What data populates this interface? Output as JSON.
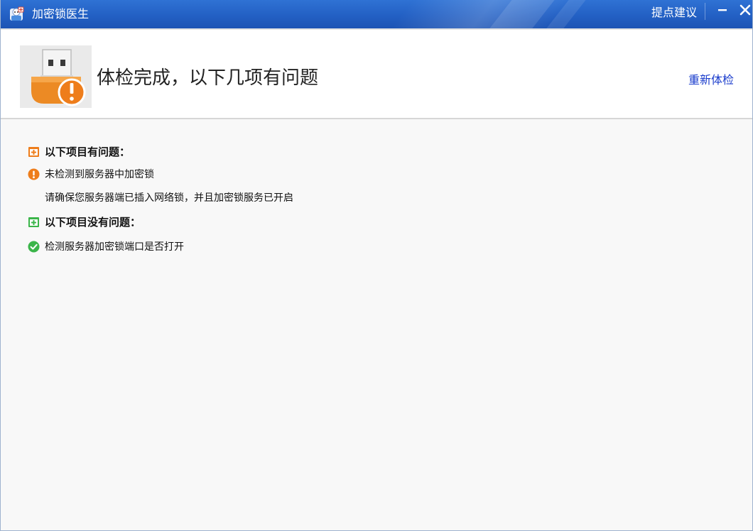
{
  "window": {
    "title": "加密锁医生",
    "feedback_link": "提点建议",
    "app_icon": "doctor-icon",
    "minimize_icon": "minimize-icon",
    "close_icon": "close-icon"
  },
  "header": {
    "image_icon": "usb-dongle-warning-icon",
    "headline": "体检完成，以下几项有问题",
    "recheck_label": "重新体检"
  },
  "results": {
    "problem_section": {
      "icon": "medical-kit-orange-icon",
      "label": "以下项目有问题："
    },
    "problem_items": [
      {
        "icon": "warning-icon",
        "label": "未检测到服务器中加密锁",
        "detail": "请确保您服务器端已插入网络锁，并且加密锁服务已开启"
      }
    ],
    "ok_section": {
      "icon": "medical-kit-green-icon",
      "label": "以下项目没有问题："
    },
    "ok_items": [
      {
        "icon": "check-circle-icon",
        "label": "检测服务器加密锁端口是否打开"
      }
    ]
  },
  "colors": {
    "titlebar": "#2360c4",
    "link": "#1a3ccc",
    "warning": "#ee7d1b",
    "ok": "#3bb54a",
    "body_bg": "#f8f8f8"
  }
}
